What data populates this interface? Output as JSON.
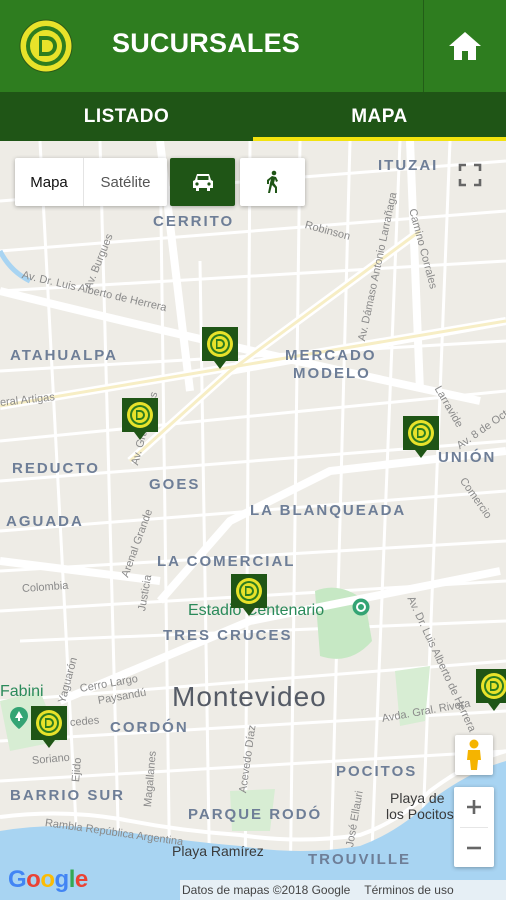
{
  "app": {
    "title": "SUCURSALES"
  },
  "tabs": [
    {
      "label": "LISTADO",
      "active": false
    },
    {
      "label": "MAPA",
      "active": true
    }
  ],
  "map_controls": {
    "map_type": "Mapa",
    "satellite": "Satélite",
    "mode_car_icon": "car-icon",
    "mode_walk_icon": "walk-icon"
  },
  "neighborhoods": {
    "ituzaingo": "ITUZAI",
    "cerrito": "CERRITO",
    "atahualpa": "ATAHUALPA",
    "mercado": "MERCADO",
    "modelo": "MODELO",
    "reducto": "REDUCTO",
    "goes": "GOES",
    "union": "UNIÓN",
    "aguada": "AGUADA",
    "blanqueada": "LA BLANQUEADA",
    "comercial": "LA COMERCIAL",
    "tres_cruces": "TRES CRUCES",
    "cordon": "CORDÓN",
    "barrio_sur": "BARRIO SUR",
    "parque_rodo": "PARQUE RODÓ",
    "pocitos": "POCITOS",
    "trouville": "TROUVILLE"
  },
  "city": "Montevideo",
  "pois": {
    "estadio": "Estadio Centenario",
    "playa_ramirez": "Playa Ramírez",
    "playa_pocitos_1": "Playa de",
    "playa_pocitos_2": "los Pocitos",
    "fabini": "Fabini"
  },
  "streets": {
    "herrera": "Av. Dr. Luis Alberto de Herrera",
    "burgues": "Av. Burgues",
    "robinson": "Robinson",
    "larranaga": "Av. Dámaso Antonio Larrañaga",
    "corrales": "Camino Corrales",
    "artigas": "eral Artigas",
    "flores": "Av. Gral. Flores",
    "larravide": "Larravide",
    "octubre": "Av. 8 de Octubre",
    "comercio": "Comercio",
    "arenal": "Arenal Grande",
    "justicia": "Justicia",
    "colombia": "Colombia",
    "yaguaron": "Yaguarón",
    "cerro_largo": "Cerro Largo",
    "paysandu": "Paysandú",
    "mercedes": "cedes",
    "ejido": "Ejido",
    "soriano": "Soriano",
    "magallanes": "Magallanes",
    "acevedo": "Acevedo Díaz",
    "rivera": "Avda. Gral. Rivera",
    "herrera2": "Av. Dr. Luis Alberto de Herrera",
    "ellauri": "José Ellauri",
    "rambla": "Rambla República Argentina"
  },
  "attribution": {
    "data": "Datos de mapas ©2018 Google",
    "terms": "Términos de uso"
  },
  "google": {
    "letters": [
      "G",
      "o",
      "o",
      "g",
      "l",
      "e"
    ]
  },
  "colors": {
    "appbar": "#2e7d1f",
    "tabbar": "#1f5516",
    "tab_indicator": "#f2e30e",
    "marker": "#1f5516",
    "logo_yellow": "#e8e22a"
  }
}
